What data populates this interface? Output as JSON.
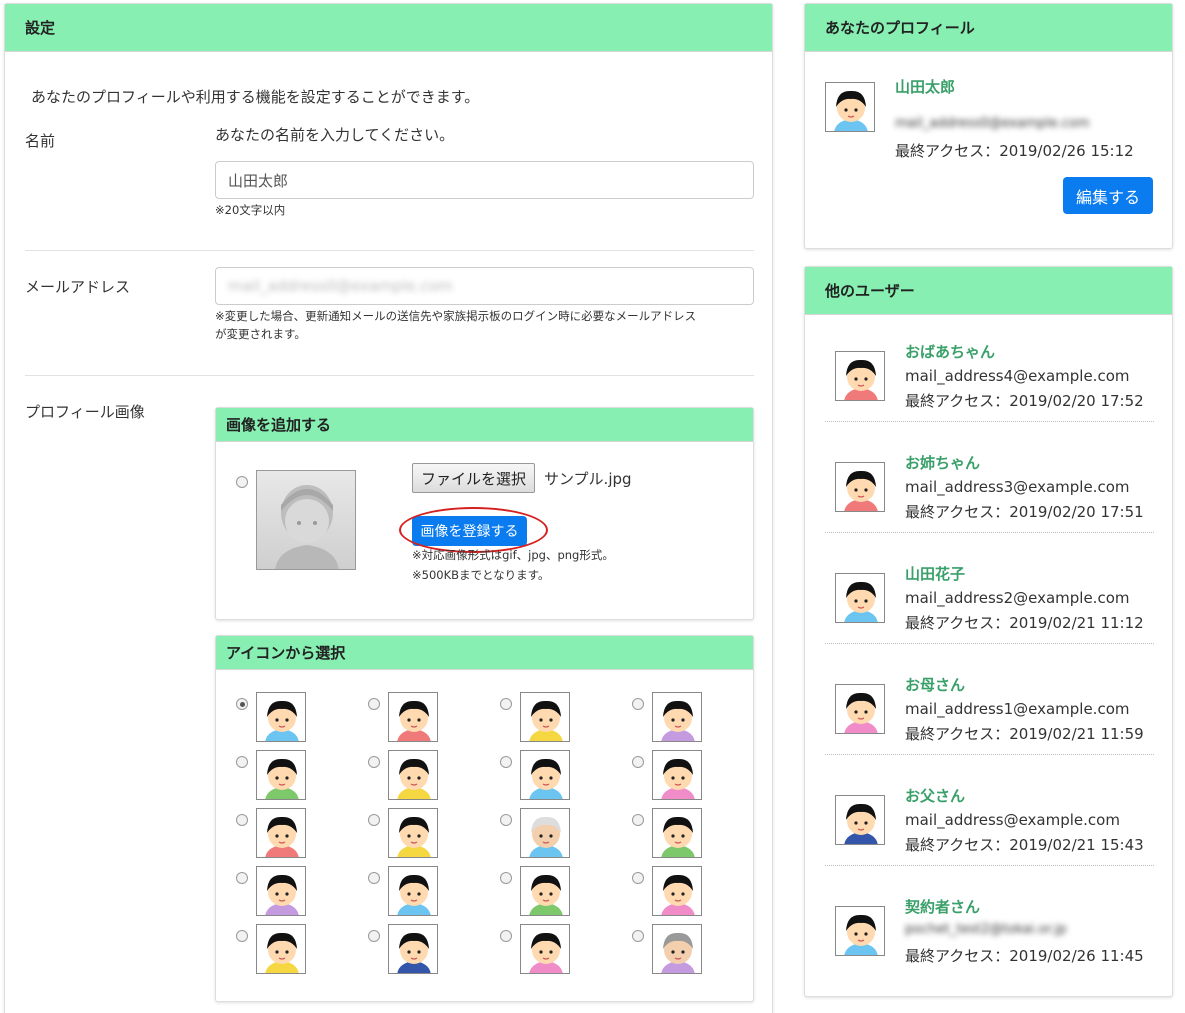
{
  "settings": {
    "title": "設定",
    "intro": "あなたのプロフィールや利用する機能を設定することができます。",
    "name_label": "名前",
    "name_hint": "あなたの名前を入力してください。",
    "name_value": "山田太郎",
    "name_note": "※20文字以内",
    "email_label": "メールアドレス",
    "email_value": "mail_address0@example.com",
    "email_note_1": "※変更した場合、更新通知メールの送信先や家族掲示板のログイン時に必要なメールアドレス",
    "email_note_2": "が変更されます。",
    "profile_image_label": "プロフィール画像",
    "add_image": {
      "title": "画像を追加する",
      "file_button": "ファイルを選択",
      "file_name": "サンプル.jpg",
      "register_button": "画像を登録する",
      "note_1": "※対応画像形式はgif、jpg、png形式。",
      "note_2": "※500KBまでとなります。"
    },
    "icon_select": {
      "title": "アイコンから選択",
      "selected_index": 0,
      "icons": [
        {
          "hair": "#111",
          "shirt": "#6cc4f0",
          "skin": "#ffd9b0"
        },
        {
          "hair": "#111",
          "shirt": "#f07a7a",
          "skin": "#ffd9b0"
        },
        {
          "hair": "#111",
          "shirt": "#f5d742",
          "skin": "#ffd9b0"
        },
        {
          "hair": "#111",
          "shirt": "#c59be0",
          "skin": "#ffd9b0"
        },
        {
          "hair": "#111",
          "shirt": "#7cc86a",
          "skin": "#ffd9b0"
        },
        {
          "hair": "#111",
          "shirt": "#f5d742",
          "skin": "#ffd9b0"
        },
        {
          "hair": "#111",
          "shirt": "#6cc4f0",
          "skin": "#ffd9b0"
        },
        {
          "hair": "#111",
          "shirt": "#f08cc8",
          "skin": "#ffd9b0"
        },
        {
          "hair": "#111",
          "shirt": "#f07a7a",
          "skin": "#ffd9b0"
        },
        {
          "hair": "#111",
          "shirt": "#f5d742",
          "skin": "#ffd9b0"
        },
        {
          "hair": "#ddd",
          "shirt": "#6cc4f0",
          "skin": "#f3cfae"
        },
        {
          "hair": "#111",
          "shirt": "#7cc86a",
          "skin": "#ffd9b0"
        },
        {
          "hair": "#111",
          "shirt": "#c59be0",
          "skin": "#ffd9b0"
        },
        {
          "hair": "#111",
          "shirt": "#6cc4f0",
          "skin": "#ffd9b0"
        },
        {
          "hair": "#111",
          "shirt": "#7cc86a",
          "skin": "#ffd9b0"
        },
        {
          "hair": "#111",
          "shirt": "#f08cc8",
          "skin": "#ffd9b0"
        },
        {
          "hair": "#111",
          "shirt": "#f5d742",
          "skin": "#ffd9b0"
        },
        {
          "hair": "#111",
          "shirt": "#3355aa",
          "skin": "#ffd9b0"
        },
        {
          "hair": "#111",
          "shirt": "#f08cc8",
          "skin": "#ffd9b0"
        },
        {
          "hair": "#999",
          "shirt": "#c59be0",
          "skin": "#f3cfae"
        }
      ]
    }
  },
  "profile": {
    "title": "あなたのプロフィール",
    "name": "山田太郎",
    "email": "mail_address0@example.com",
    "last_access": "最終アクセス：2019/02/26 15:12",
    "edit_button": "編集する"
  },
  "others": {
    "title": "他のユーザー",
    "users": [
      {
        "name": "おばあちゃん",
        "email": "mail_address4@example.com",
        "last_access": "最終アクセス：2019/02/20 17:52",
        "shirt": "#f07a7a",
        "blurred": false
      },
      {
        "name": "お姉ちゃん",
        "email": "mail_address3@example.com",
        "last_access": "最終アクセス：2019/02/20 17:51",
        "shirt": "#f07a7a",
        "blurred": false
      },
      {
        "name": "山田花子",
        "email": "mail_address2@example.com",
        "last_access": "最終アクセス：2019/02/21 11:12",
        "shirt": "#6cc4f0",
        "blurred": false
      },
      {
        "name": "お母さん",
        "email": "mail_address1@example.com",
        "last_access": "最終アクセス：2019/02/21 11:59",
        "shirt": "#f08cc8",
        "blurred": false
      },
      {
        "name": "お父さん",
        "email": "mail_address@example.com",
        "last_access": "最終アクセス：2019/02/21 15:43",
        "shirt": "#3355aa",
        "blurred": false
      },
      {
        "name": "契約者さん",
        "email": "pochet_test2@tokai.or.jp",
        "last_access": "最終アクセス：2019/02/26 11:45",
        "shirt": "#6cc4f0",
        "blurred": true
      }
    ]
  }
}
